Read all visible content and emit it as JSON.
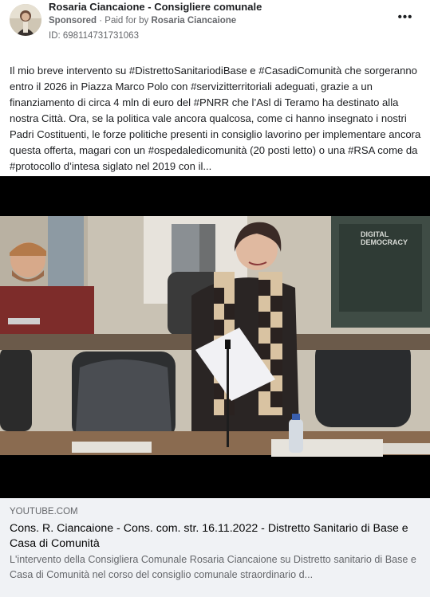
{
  "header": {
    "page_name": "Rosaria Ciancaione - Consigliere comunale",
    "sponsored": "Sponsored",
    "paid_for_prefix": "· Paid for by",
    "paid_for_name": "Rosaria Ciancaione",
    "ad_id": "ID: 698114731731063",
    "more_icon": "more-horizontal-icon"
  },
  "post": {
    "text": "Il mio breve intervento su #DistrettoSanitariodiBase e #CasadiComunità che sorgeranno entro il 2026 in Piazza Marco Polo con #servizitterritoriali adeguati, grazie a un finanziamento di circa 4 mln di euro del #PNRR che l’Asl di Teramo ha destinato alla nostra Città. Ora, se la politica vale ancora qualcosa, come ci hanno insegnato i nostri Padri Costituenti, le forze politiche presenti in consiglio lavorino per implementare ancora questa offerta, magari con un #ospedaledicomunità (20 posti letto) o una #RSA come da #protocollo d’intesa siglato nel 2019 con il..."
  },
  "video": {
    "watermark_line1": "DIGITAL",
    "watermark_line2": "DEMOCRACY"
  },
  "link_preview": {
    "domain": "YOUTUBE.COM",
    "title": "Cons. R. Ciancaione - Cons. com. str. 16.11.2022 - Distretto Sanitario di Base e Casa di Comunità",
    "description": "L'intervento della Consigliera Comunale Rosaria Ciancaione su Distretto sanitario di Base e Casa di Comunità nel corso del consiglio comunale straordinario d..."
  },
  "colors": {
    "text_primary": "#1c1e21",
    "text_secondary": "#65676b",
    "link_bg": "#f0f2f5"
  }
}
